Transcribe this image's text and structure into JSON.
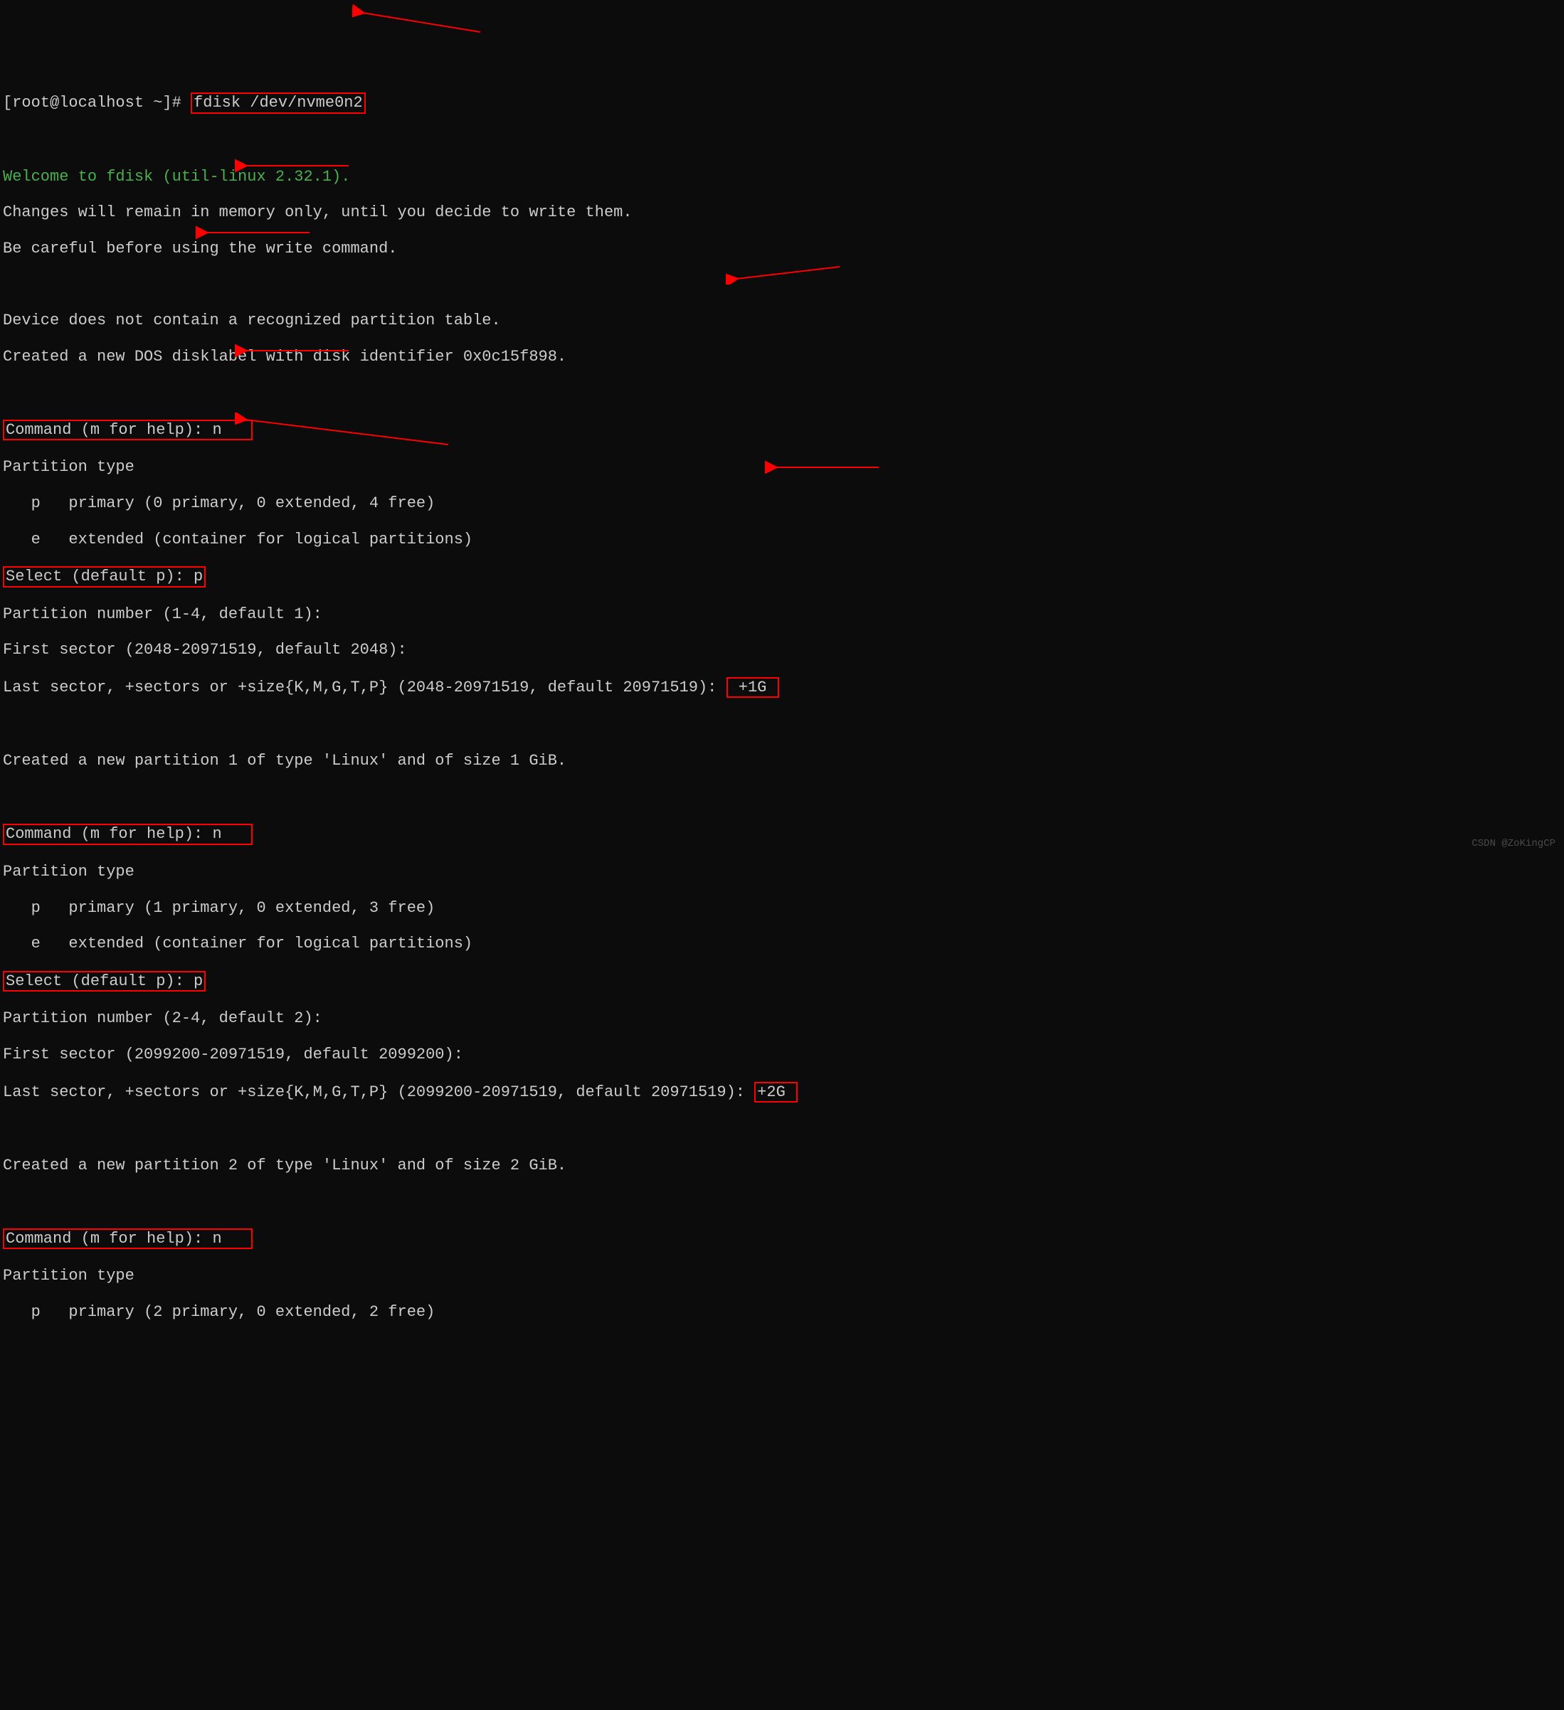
{
  "terminal": {
    "prompt_prefix": "[root@localhost ~]# ",
    "command": "fdisk /dev/nvme0n2",
    "welcome": "Welcome to fdisk (util-linux 2.32.1).",
    "changes_line": "Changes will remain in memory only, until you decide to write them.",
    "careful_line": "Be careful before using the write command.",
    "no_partition": "Device does not contain a recognized partition table.",
    "created_dos": "Created a new DOS disklabel with disk identifier 0x0c15f898.",
    "cmd_prompt_prefix": "Command (m for help): ",
    "cmd_n": "n",
    "partition_type": "Partition type",
    "primary_0": "   p   primary (0 primary, 0 extended, 4 free)",
    "primary_1": "   p   primary (1 primary, 0 extended, 3 free)",
    "primary_2": "   p   primary (2 primary, 0 extended, 2 free)",
    "extended": "   e   extended (container for logical partitions)",
    "select_prefix": "Select (default p): ",
    "select_p": "p",
    "part_num_1": "Partition number (1-4, default 1):",
    "part_num_2": "Partition number (2-4, default 2):",
    "first_sector_1": "First sector (2048-20971519, default 2048):",
    "first_sector_2": "First sector (2099200-20971519, default 2099200):",
    "last_sector_1_prefix": "Last sector, +sectors or +size{K,M,G,T,P} (2048-20971519, default 20971519): ",
    "last_sector_2_prefix": "Last sector, +sectors or +size{K,M,G,T,P} (2099200-20971519, default 20971519): ",
    "plus_1g": "+1G",
    "plus_2g": "+2G",
    "created_p1": "Created a new partition 1 of type 'Linux' and of size 1 GiB.",
    "created_p2": "Created a new partition 2 of type 'Linux' and of size 2 GiB."
  },
  "watermark": "CSDN @ZoKingCP"
}
